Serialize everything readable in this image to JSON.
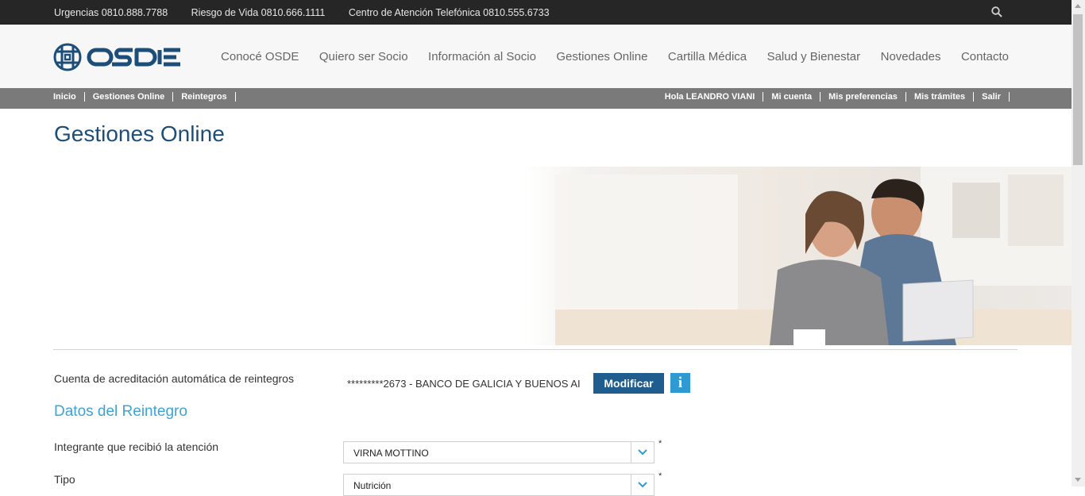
{
  "topbar": {
    "phones": [
      "Urgencias 0810.888.7788",
      "Riesgo de Vida 0810.666.1111",
      "Centro de Atención Telefónica 0810.555.6733"
    ],
    "search_icon": "search-icon"
  },
  "nav": {
    "items": [
      "Conocé OSDE",
      "Quiero ser Socio",
      "Información al Socio",
      "Gestiones Online",
      "Cartilla Médica",
      "Salud y Bienestar",
      "Novedades",
      "Contacto"
    ]
  },
  "breadcrumb": [
    "Inicio",
    "Gestiones Online",
    "Reintegros"
  ],
  "usermenu": [
    "Hola LEANDRO VIANI",
    "Mi cuenta",
    "Mis preferencias",
    "Mis trámites",
    "Salir"
  ],
  "page": {
    "title": "Gestiones Online"
  },
  "account": {
    "label": "Cuenta de acreditación automática de reintegros",
    "value": "*********2673 - BANCO DE GALICIA Y BUENOS AI",
    "modify_label": "Modificar",
    "info_label": "i"
  },
  "section": {
    "title": "Datos del Reintegro"
  },
  "form": {
    "member_label": "Integrante que recibió la atención",
    "member_value": "VIRNA MOTTINO",
    "type_label": "Tipo",
    "type_value": "Nutrición",
    "required_mark": "*"
  },
  "colors": {
    "brand": "#1d4e79",
    "accent": "#3fa3d6",
    "button": "#1f5d8e"
  }
}
